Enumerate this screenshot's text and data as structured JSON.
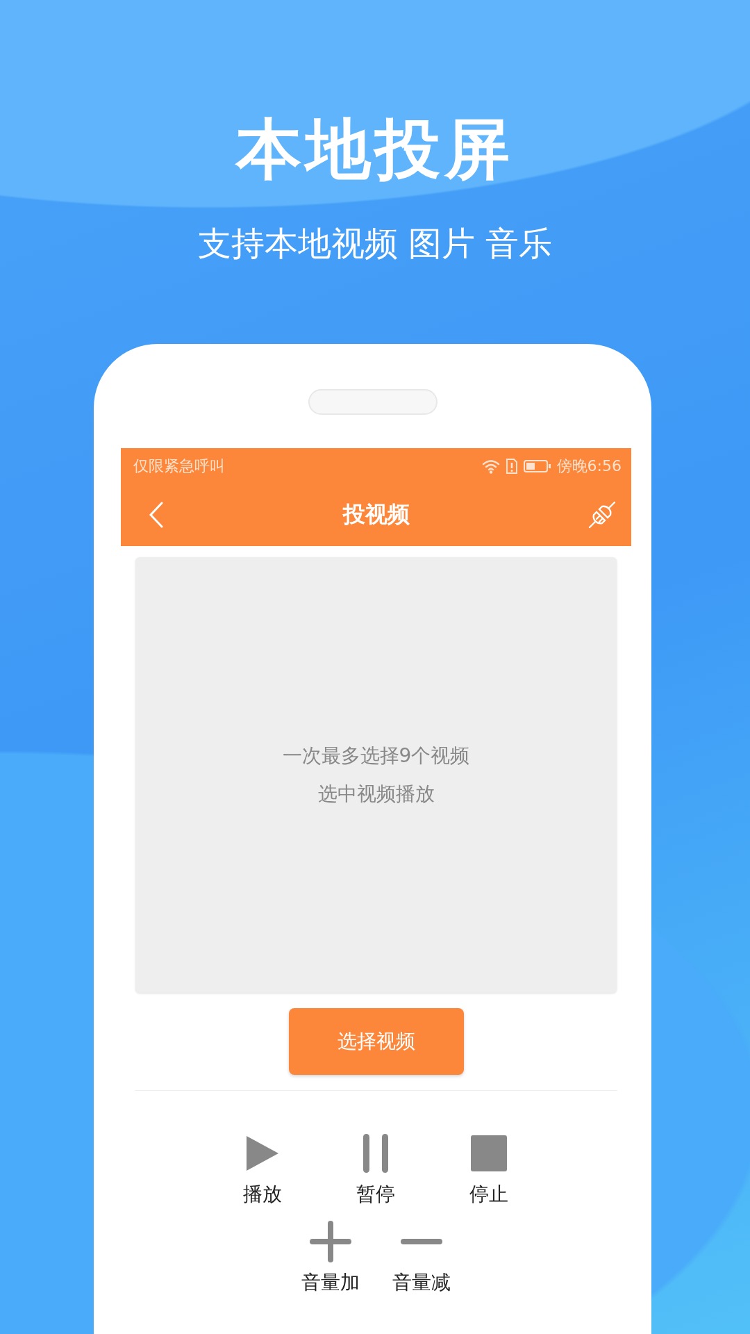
{
  "headline": "本地投屏",
  "subheadline": "支持本地视频 图片 音乐",
  "status_bar": {
    "carrier": "仅限紧急呼叫",
    "time": "傍晚6:56"
  },
  "nav": {
    "title": "投视频"
  },
  "video_area": {
    "lines": [
      "一次最多选择9个视频",
      "选中视频播放"
    ]
  },
  "select_button": "选择视频",
  "controls": [
    {
      "kind": "play",
      "label": "播放"
    },
    {
      "kind": "pause",
      "label": "暂停"
    },
    {
      "kind": "stop",
      "label": "停止"
    }
  ],
  "volume": [
    {
      "kind": "plus",
      "label": "音量加"
    },
    {
      "kind": "minus",
      "label": "音量减"
    }
  ]
}
